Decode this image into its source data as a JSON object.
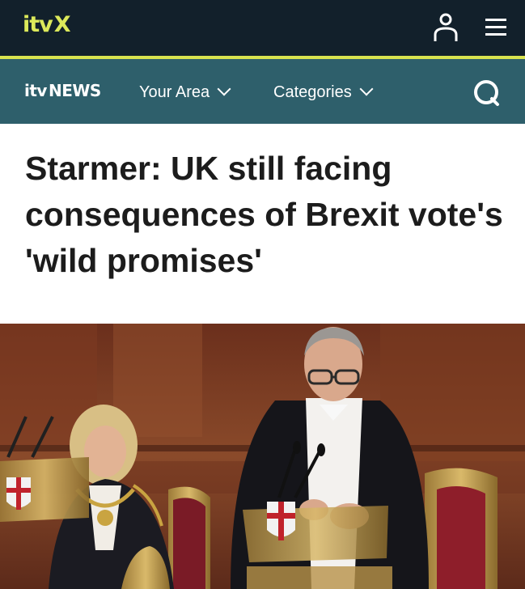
{
  "topbar": {
    "brand": "itvX",
    "logo_main": "itv",
    "logo_x": "X",
    "account_icon": "account-icon",
    "menu_icon": "hamburger-menu-icon"
  },
  "newsnav": {
    "brand_itv": "itv",
    "brand_news": "NEWS",
    "items": [
      {
        "label": "Your Area"
      },
      {
        "label": "Categories"
      }
    ],
    "search_icon": "search-icon"
  },
  "article": {
    "headline": "Starmer: UK still facing consequences of Brexit vote's 'wild promises'"
  },
  "colors": {
    "topbar_bg": "#12202b",
    "accent": "#d8e34f",
    "news_bar_bg": "#2e5f6b",
    "logo": "#dce95a"
  }
}
